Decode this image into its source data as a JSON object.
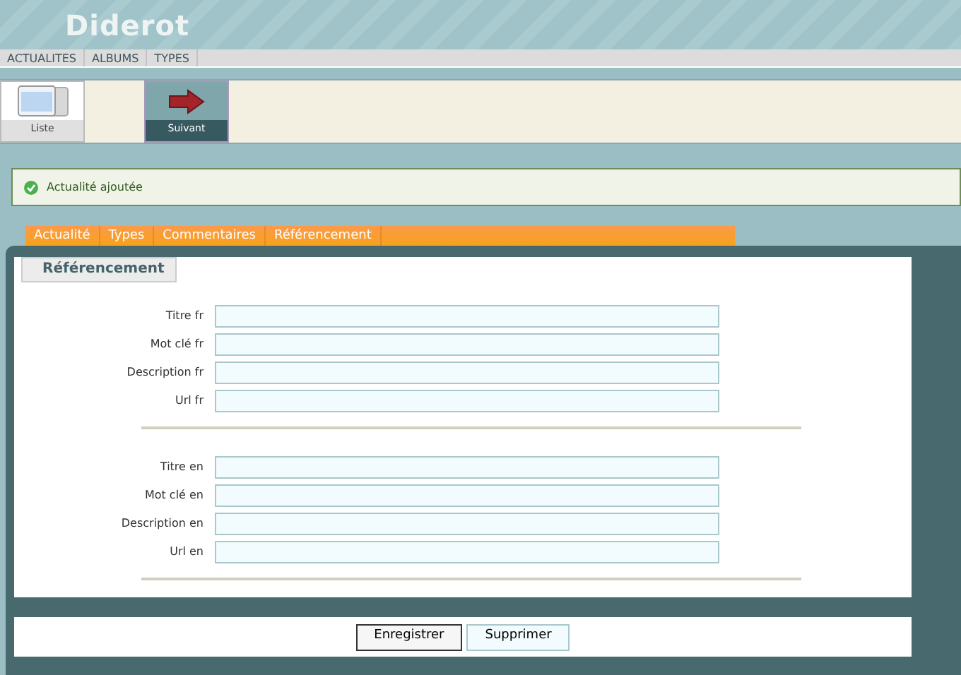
{
  "site_title": "Diderot",
  "nav": [
    "ACTUALITES",
    "ALBUMS",
    "TYPES"
  ],
  "toolbar": [
    {
      "label": "Liste",
      "kind": "list"
    },
    {
      "label": "Suivant",
      "kind": "next"
    }
  ],
  "message": "Actualité ajoutée",
  "tabs": [
    "Actualité",
    "Types",
    "Commentaires",
    "Référencement"
  ],
  "section_title": "Référencement",
  "groups": [
    {
      "fields": [
        "Titre fr",
        "Mot clé fr",
        "Description fr",
        "Url fr"
      ]
    },
    {
      "fields": [
        "Titre en",
        "Mot clé en",
        "Description en",
        "Url en"
      ]
    }
  ],
  "buttons": [
    "Enregistrer",
    "Supprimer"
  ]
}
